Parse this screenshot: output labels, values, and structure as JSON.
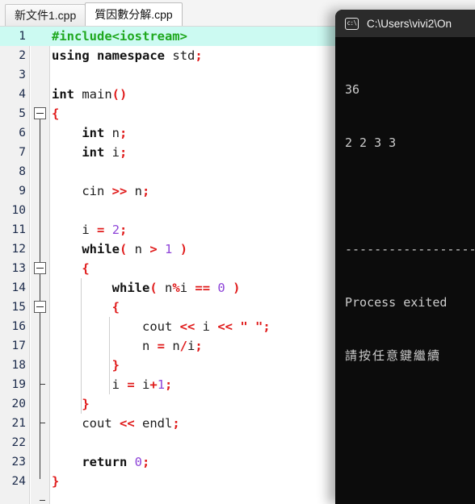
{
  "tabs": [
    {
      "label": "新文件1.cpp",
      "active": false
    },
    {
      "label": "質因數分解.cpp",
      "active": true
    }
  ],
  "editor": {
    "current_line": 1,
    "highlight_color": "#ccfaf2",
    "line_count": 24,
    "line_numbers": [
      "1",
      "2",
      "3",
      "4",
      "5",
      "6",
      "7",
      "8",
      "9",
      "10",
      "11",
      "12",
      "13",
      "14",
      "15",
      "16",
      "17",
      "18",
      "19",
      "20",
      "21",
      "22",
      "23",
      "24"
    ],
    "lines": [
      {
        "n": 1,
        "text": "#include<iostream>"
      },
      {
        "n": 2,
        "text": "using namespace std;"
      },
      {
        "n": 3,
        "text": ""
      },
      {
        "n": 4,
        "text": "int main()"
      },
      {
        "n": 5,
        "text": "{"
      },
      {
        "n": 6,
        "text": "    int n;"
      },
      {
        "n": 7,
        "text": "    int i;"
      },
      {
        "n": 8,
        "text": ""
      },
      {
        "n": 9,
        "text": "    cin >> n;"
      },
      {
        "n": 10,
        "text": ""
      },
      {
        "n": 11,
        "text": "    i = 2;"
      },
      {
        "n": 12,
        "text": "    while( n > 1 )"
      },
      {
        "n": 13,
        "text": "    {"
      },
      {
        "n": 14,
        "text": "        while( n%i == 0 )"
      },
      {
        "n": 15,
        "text": "        {"
      },
      {
        "n": 16,
        "text": "            cout << i << \" \";"
      },
      {
        "n": 17,
        "text": "            n = n/i;"
      },
      {
        "n": 18,
        "text": "        }"
      },
      {
        "n": 19,
        "text": "        i = i+1;"
      },
      {
        "n": 20,
        "text": "    }"
      },
      {
        "n": 21,
        "text": "    cout << endl;"
      },
      {
        "n": 22,
        "text": ""
      },
      {
        "n": 23,
        "text": "    return 0;"
      },
      {
        "n": 24,
        "text": "}"
      }
    ],
    "fold_markers": [
      {
        "line": 5,
        "type": "open"
      },
      {
        "line": 13,
        "type": "open"
      },
      {
        "line": 15,
        "type": "open"
      },
      {
        "line": 18,
        "type": "close"
      },
      {
        "line": 20,
        "type": "close"
      },
      {
        "line": 24,
        "type": "end"
      }
    ],
    "colors": {
      "keyword": "#111111",
      "preprocessor": "#1fa81f",
      "number": "#8e44d8",
      "operator": "#e01b1b",
      "string": "#e01b1b",
      "plain": "#1d1d1d",
      "linenumber": "#1b2a4a",
      "gutter_bg": "#f1f1f1"
    }
  },
  "console": {
    "title": "C:\\Users\\vivi2\\On",
    "icon": "cmd-prompt-icon",
    "icon_glyph": "c:\\",
    "bg": "#0c0c0c",
    "titlebar_bg": "#2b2b2b",
    "text_color": "#cccccc",
    "output": [
      "36",
      "2 2 3 3",
      "",
      "--------------------",
      "Process exited",
      "請按任意鍵繼續"
    ]
  }
}
